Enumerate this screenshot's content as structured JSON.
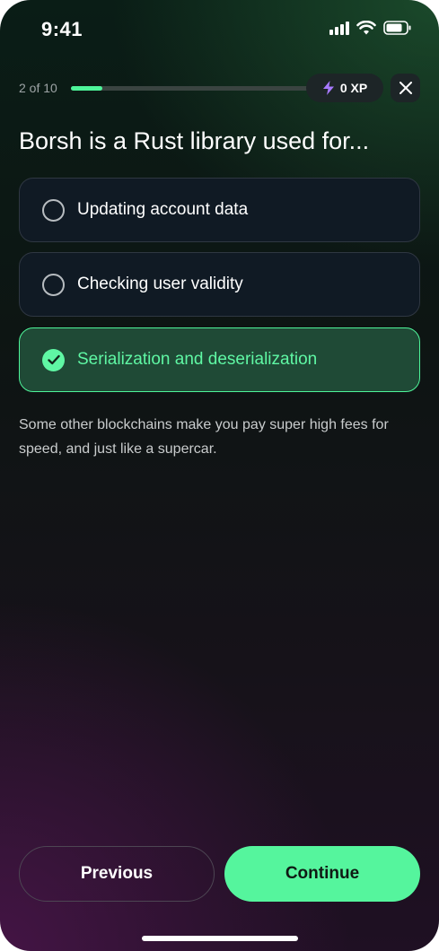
{
  "status_bar": {
    "time": "9:41",
    "icons": [
      "cellular-signal-icon",
      "wifi-icon",
      "battery-icon"
    ]
  },
  "header": {
    "progress_text": "2 of 10",
    "progress_fraction": 0.13,
    "xp_label": "0 XP",
    "xp_icon": "lightning-bolt-icon",
    "close_icon": "close-icon"
  },
  "question": {
    "text": "Borsh is a Rust library used for..."
  },
  "options": [
    {
      "label": "Updating account data",
      "selected": false
    },
    {
      "label": "Checking user validity",
      "selected": false
    },
    {
      "label": "Serialization and deserialization",
      "selected": true
    }
  ],
  "explanation": "Some other blockchains make you pay super high fees for speed, and just like a supercar.",
  "buttons": {
    "previous": "Previous",
    "continue": "Continue"
  },
  "colors": {
    "accent": "#4ef59a",
    "selected_bg": "#1f4a36",
    "xp_bolt": "#a779ff"
  }
}
